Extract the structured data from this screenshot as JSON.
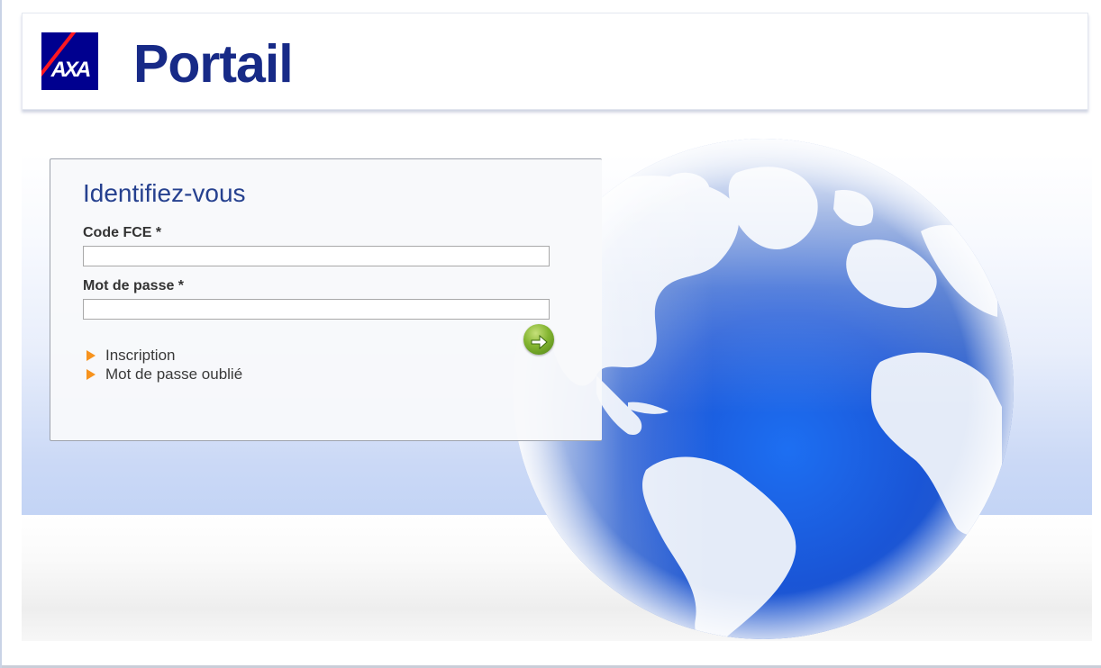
{
  "header": {
    "logo_text": "AXA",
    "title": "Portail"
  },
  "login": {
    "heading": "Identifiez-vous",
    "code_label": "Code FCE *",
    "code_value": "",
    "password_label": "Mot de passe *",
    "password_value": "",
    "submit_icon": "arrow-right-icon",
    "links": [
      {
        "label": "Inscription",
        "icon": "triangle-right-icon"
      },
      {
        "label": "Mot de passe oublié",
        "icon": "triangle-right-icon"
      }
    ]
  },
  "colors": {
    "brand_blue": "#172a87",
    "logo_blue": "#00008f",
    "logo_red": "#ff1721",
    "heading_blue": "#26418f",
    "link_arrow_orange": "#f7931e",
    "submit_green": "#84b531"
  }
}
